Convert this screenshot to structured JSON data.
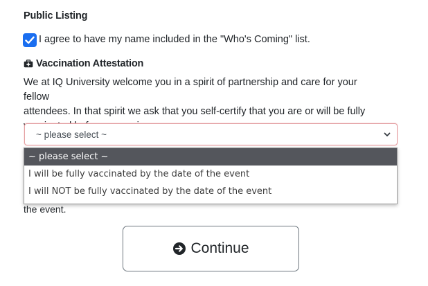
{
  "public_listing": {
    "title": "Public Listing",
    "checkbox_checked": true,
    "checkbox_label": "I agree to have my name included in the \"Who's Coming\" list."
  },
  "vaccination": {
    "title": "Vaccination Attestation",
    "icon": "medkit-icon",
    "paragraph_line1": "We at IQ University welcome you in a spirit of partnership and care for your fellow",
    "paragraph_line2": "attendees. In that spirit we ask that you self-certify that you are or will be fully",
    "paragraph_line3": "vaccinated before you arrive on campus."
  },
  "select": {
    "value": "~ please select ~",
    "options": [
      "~ please select ~",
      "I will be fully vaccinated by the date of the event",
      "I will NOT be fully vaccinated by the date of the event"
    ],
    "selected_index": 0
  },
  "obscured_text": "the event.",
  "continue_button": {
    "label": "Continue",
    "icon": "circle-arrow-right-icon"
  }
}
